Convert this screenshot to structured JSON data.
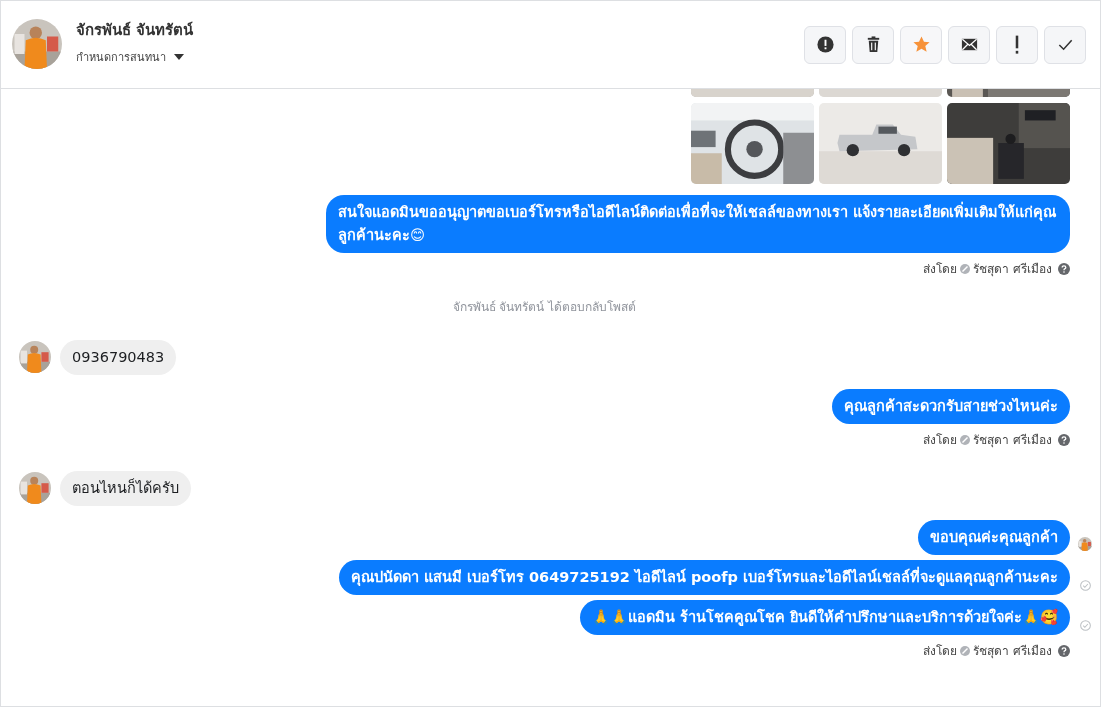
{
  "header": {
    "name": "จักรพันธ์ จันทรัตน์",
    "subtitle": "กำหนดการสนทนา",
    "buttons": [
      {
        "kind": "alert",
        "on": false
      },
      {
        "kind": "trash",
        "on": false
      },
      {
        "kind": "star",
        "on": true
      },
      {
        "kind": "mail",
        "on": false
      },
      {
        "kind": "exclaim",
        "on": false
      },
      {
        "kind": "check",
        "on": false
      }
    ]
  },
  "messages": [
    {
      "kind": "photos"
    },
    {
      "kind": "outgoing",
      "text": "สนใจแอดมินขออนุญาตขอเบอร์โทรหรือไอดีไลน์ติดต่อเพื่อที่จะให้เชลล์ของทางเรา แจ้งรายละเอียดเพิ่มเติมให้แก่คุณลูกค้านะคะ😊"
    },
    {
      "kind": "sent_by",
      "label": "ส่งโดย",
      "agent": "รัชสุดา ศรีเมือง"
    },
    {
      "kind": "notice",
      "text": "จักรพันธ์ จันทรัตน์ ได้ตอบกลับโพสต์"
    },
    {
      "kind": "incoming",
      "text": "0936790483"
    },
    {
      "kind": "outgoing",
      "text": "คุณลูกค้าสะดวกรับสายช่วงไหนค่ะ"
    },
    {
      "kind": "sent_by",
      "label": "ส่งโดย",
      "agent": "รัชสุดา ศรีเมือง"
    },
    {
      "kind": "incoming",
      "text": "ตอนไหนก็ได้ครับ"
    },
    {
      "kind": "outgoing",
      "text": "ขอบคุณค่ะคุณลูกค้า",
      "read": true
    },
    {
      "kind": "outgoing",
      "text": "คุณปนัดดา แสนมี   เบอร์โทร 0649725192  ไอดีไลน์ poofp   เบอร์โทรและไอดีไลน์เชลล์ที่จะดูแลคุณลูกค้านะคะ",
      "read": false
    },
    {
      "kind": "outgoing",
      "text": "🙏🙏แอดมิน ร้านโชคคูณโชค ยินดีให้คำปรึกษาและบริการด้วยใจค่ะ🙏🥰",
      "read": false
    },
    {
      "kind": "sent_by",
      "label": "ส่งโดย",
      "agent": "รัชสุดา ศรีเมือง"
    }
  ]
}
